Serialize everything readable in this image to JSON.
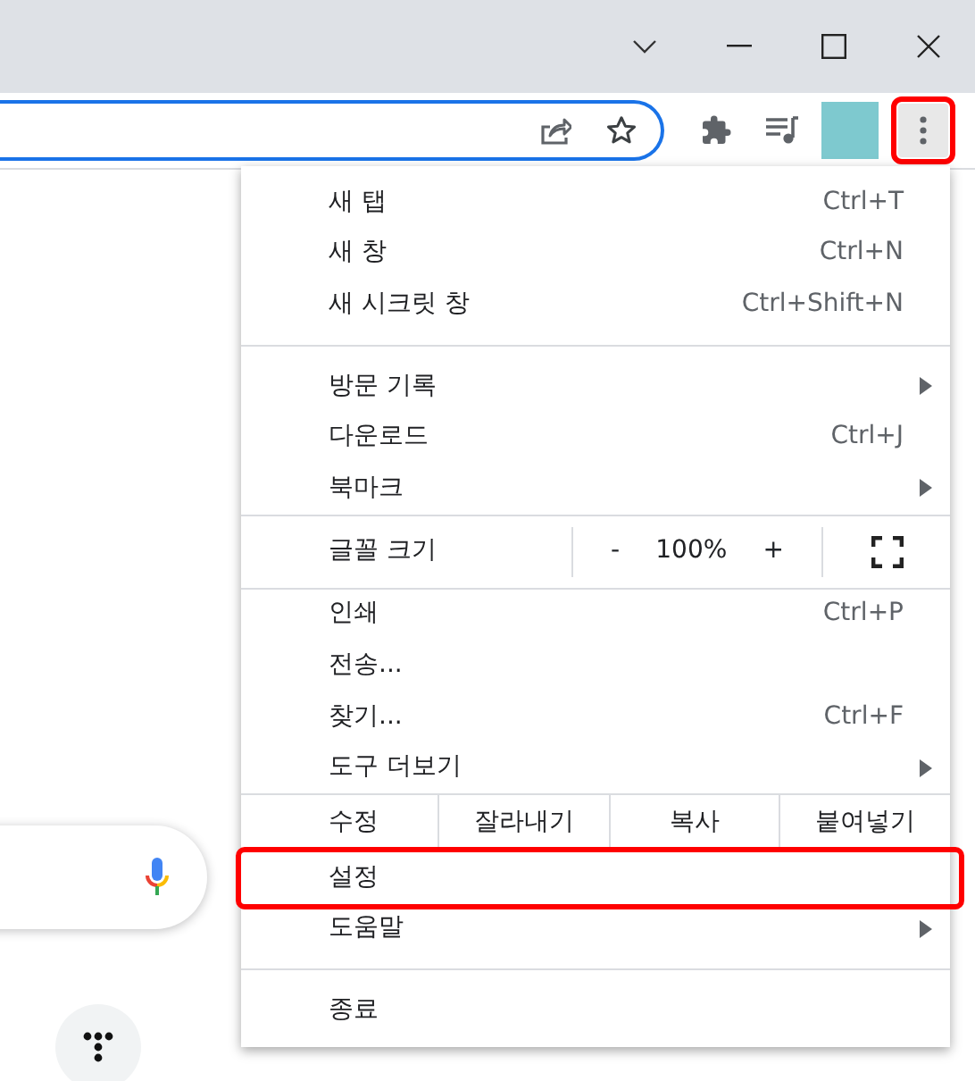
{
  "toolbar": {
    "menu_button": {
      "highlighted": true
    }
  },
  "menu": {
    "sections": [
      {
        "items": [
          {
            "kind": "item",
            "label": "새 탭",
            "shortcut": "Ctrl+T",
            "submenu": false,
            "highlighted": false
          },
          {
            "kind": "item",
            "label": "새 창",
            "shortcut": "Ctrl+N",
            "submenu": false,
            "highlighted": false
          },
          {
            "kind": "item",
            "label": "새 시크릿 창",
            "shortcut": "Ctrl+Shift+N",
            "submenu": false,
            "highlighted": false
          }
        ]
      },
      {
        "items": [
          {
            "kind": "item",
            "label": "방문 기록",
            "submenu": true,
            "highlighted": false
          },
          {
            "kind": "item",
            "label": "다운로드",
            "shortcut": "Ctrl+J",
            "submenu": false,
            "highlighted": false
          },
          {
            "kind": "item",
            "label": "북마크",
            "submenu": true,
            "highlighted": false
          }
        ]
      },
      {
        "items": [
          {
            "kind": "zoom",
            "label": "글꼴 크기",
            "minus": "-",
            "value": "100%",
            "plus": "+"
          }
        ]
      },
      {
        "items": [
          {
            "kind": "item",
            "label": "인쇄",
            "shortcut": "Ctrl+P",
            "submenu": false,
            "highlighted": false
          },
          {
            "kind": "item",
            "label": "전송...",
            "submenu": false,
            "highlighted": false
          },
          {
            "kind": "item",
            "label": "찾기...",
            "shortcut": "Ctrl+F",
            "submenu": false,
            "highlighted": false
          },
          {
            "kind": "item",
            "label": "도구 더보기",
            "submenu": true,
            "highlighted": false
          }
        ]
      },
      {
        "items": [
          {
            "kind": "edit",
            "label": "수정",
            "buttons": [
              "잘라내기",
              "복사",
              "붙여넣기"
            ]
          },
          {
            "kind": "item",
            "label": "설정",
            "submenu": false,
            "highlighted": true
          },
          {
            "kind": "item",
            "label": "도움말",
            "submenu": true,
            "highlighted": false
          }
        ]
      },
      {
        "items": [
          {
            "kind": "item",
            "label": "종료",
            "submenu": false,
            "highlighted": false
          }
        ]
      }
    ]
  }
}
